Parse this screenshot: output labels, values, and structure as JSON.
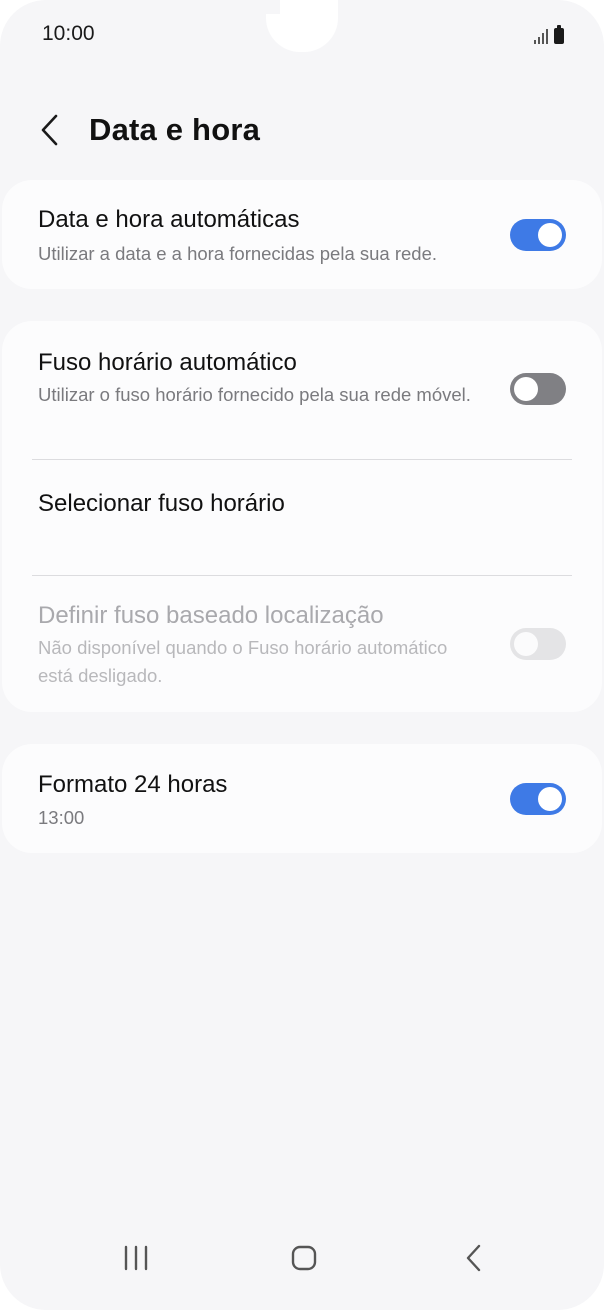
{
  "status_bar": {
    "time": "10:00"
  },
  "header": {
    "back_icon": "chevron-left-icon",
    "title": "Data e hora"
  },
  "settings": {
    "auto_datetime": {
      "title": "Data e hora automáticas",
      "subtitle": "Utilizar a data e a hora fornecidas pela sua rede.",
      "enabled": true
    },
    "auto_timezone": {
      "title": "Fuso horário automático",
      "subtitle": "Utilizar o fuso horário fornecido pela sua rede móvel.",
      "enabled": false
    },
    "select_timezone": {
      "title": "Selecionar fuso horário"
    },
    "location_timezone": {
      "title": "Definir fuso baseado localização",
      "subtitle": "Não disponível quando o Fuso horário automático está desligado.",
      "enabled": false,
      "disabled": true
    },
    "format_24h": {
      "title": "Formato 24 horas",
      "subtitle": "13:00",
      "enabled": true
    }
  },
  "colors": {
    "accent": "#3e7ae6",
    "background": "#f6f6f8",
    "card": "#fcfcfd"
  },
  "nav_bar": {
    "recents_icon": "recents-icon",
    "home_icon": "home-icon",
    "back_icon": "back-icon"
  }
}
